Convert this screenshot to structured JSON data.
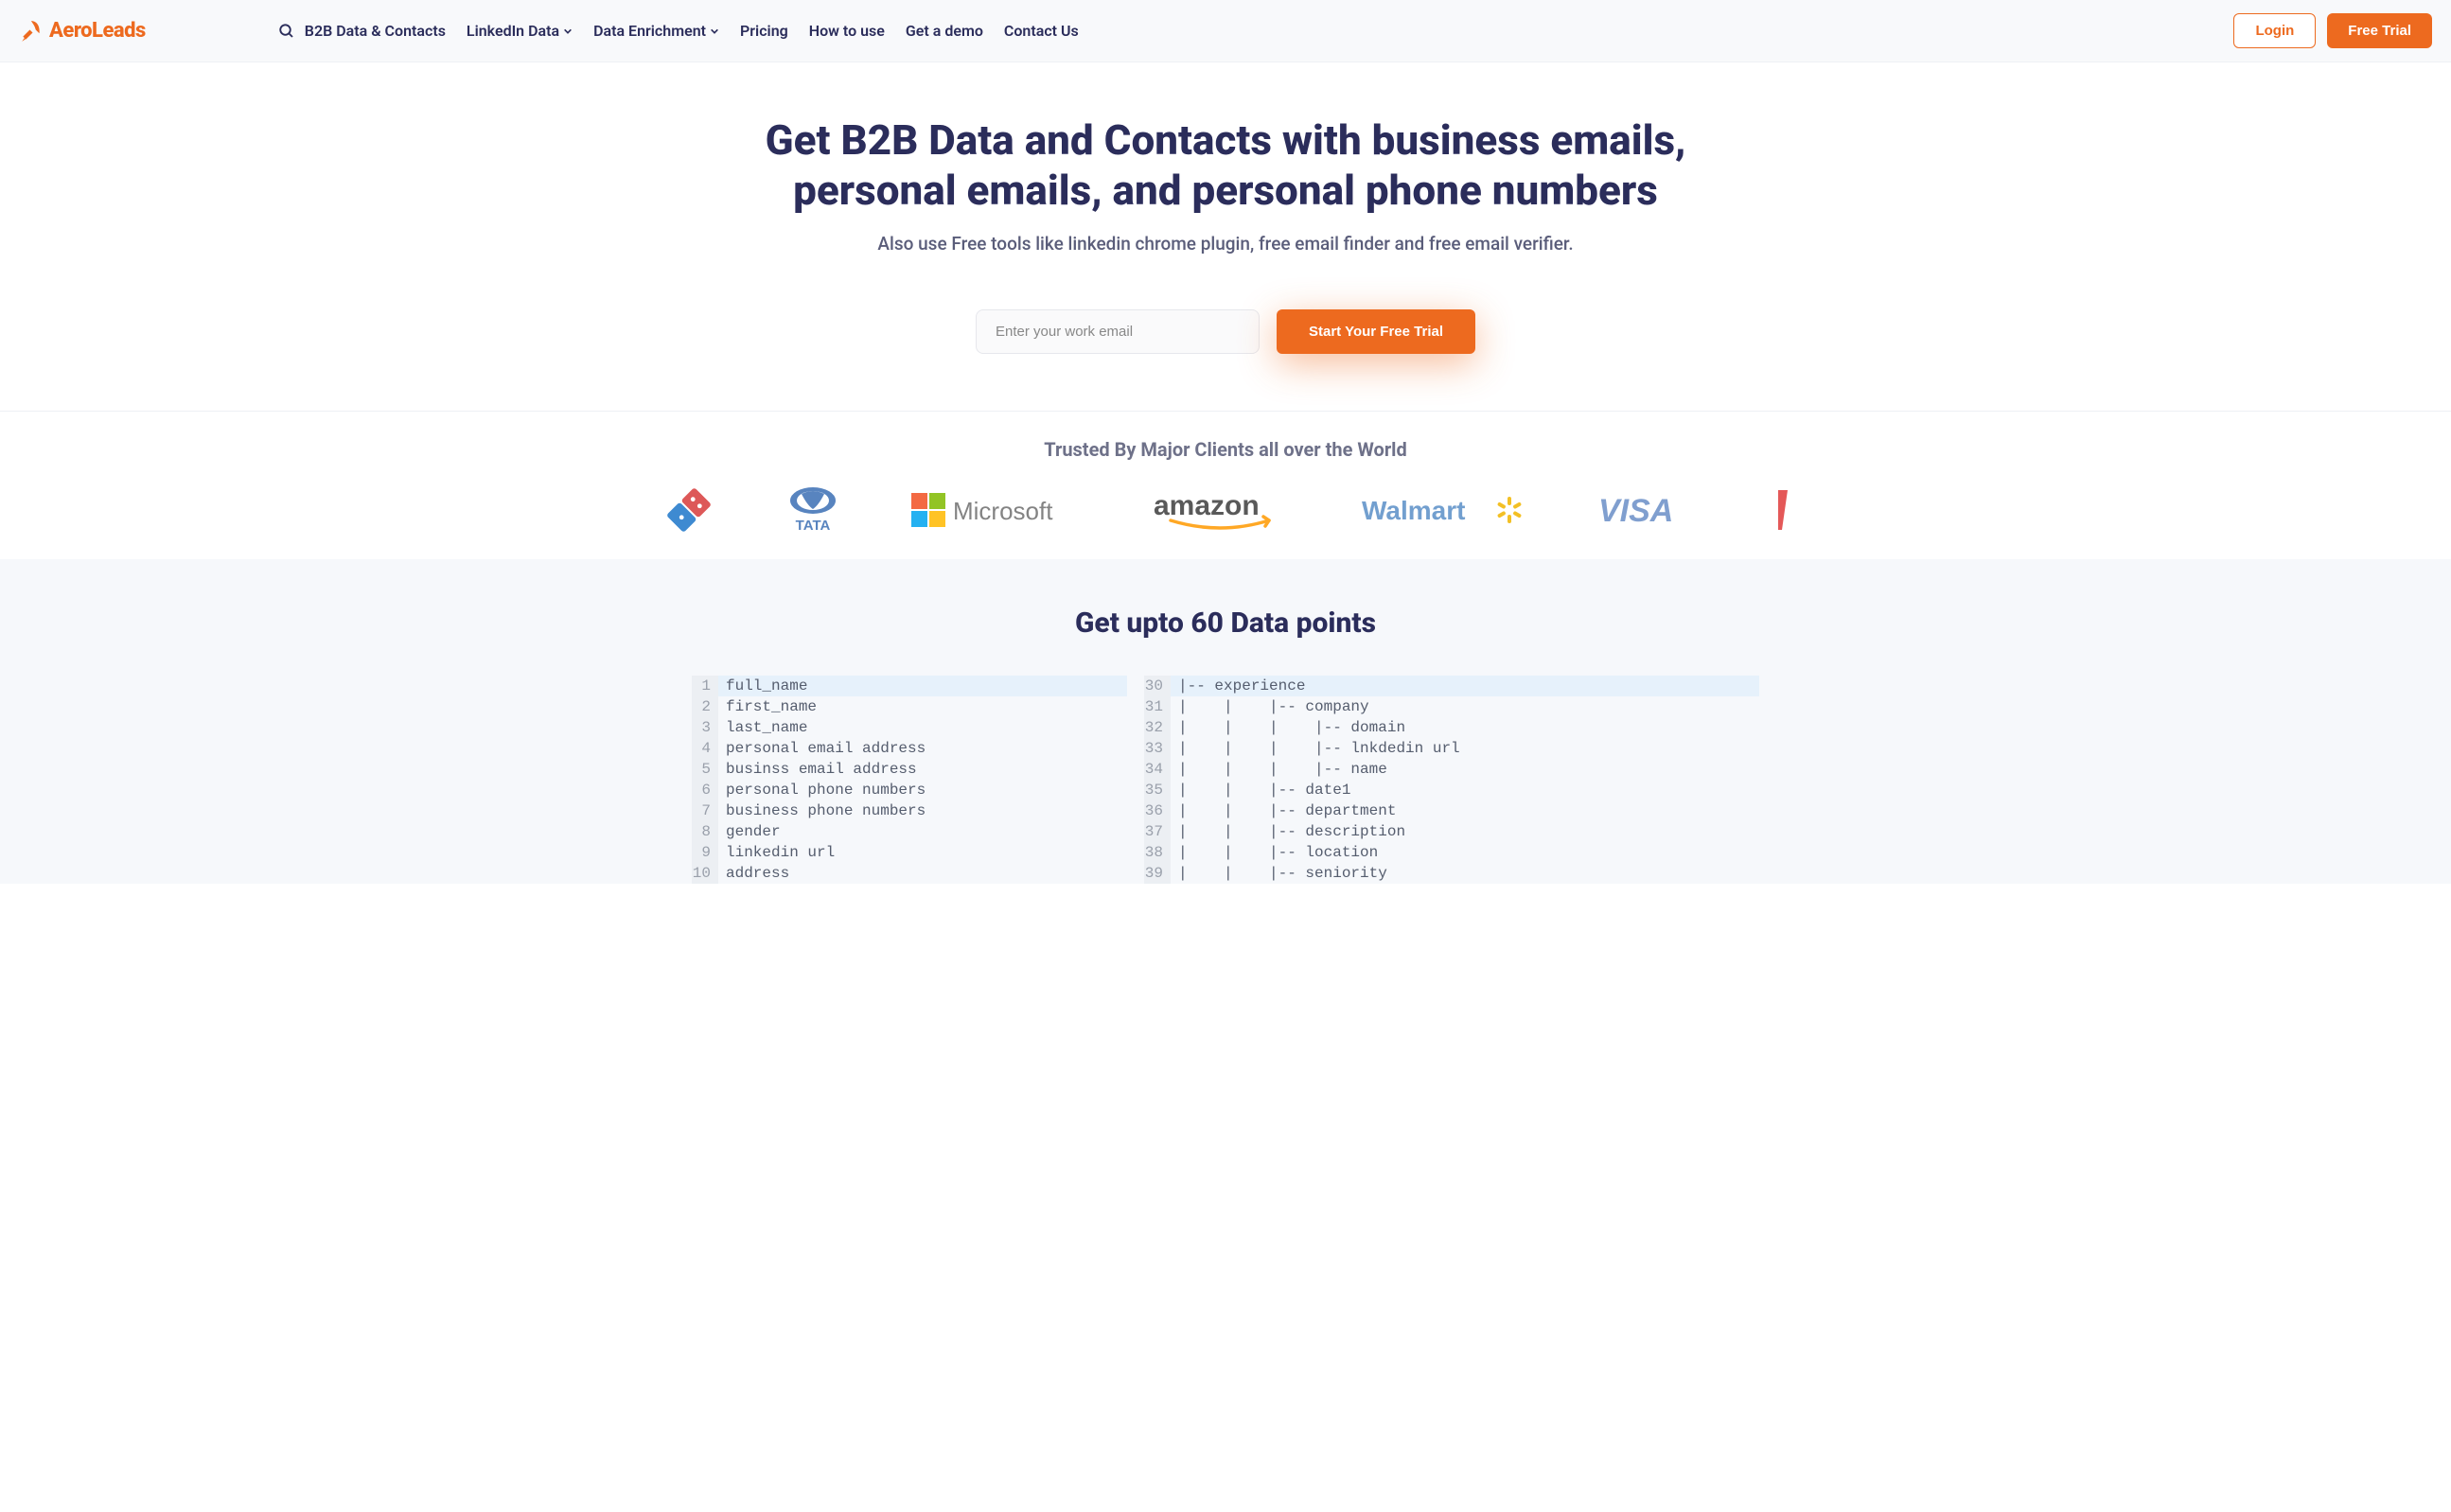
{
  "brand": {
    "name": "AeroLeads"
  },
  "nav": {
    "items": [
      {
        "label": "B2B Data & Contacts",
        "hasSearch": true
      },
      {
        "label": "LinkedIn Data",
        "dropdown": true
      },
      {
        "label": "Data Enrichment",
        "dropdown": true
      },
      {
        "label": "Pricing"
      },
      {
        "label": "How to use"
      },
      {
        "label": "Get a demo"
      },
      {
        "label": "Contact Us"
      }
    ]
  },
  "auth": {
    "login": "Login",
    "trial": "Free Trial"
  },
  "hero": {
    "title": "Get B2B Data and Contacts with business emails, personal emails, and personal phone numbers",
    "subtitle": "Also use Free tools like linkedin chrome plugin, free email finder and free email verifier.",
    "emailPlaceholder": "Enter your work email",
    "cta": "Start Your Free Trial"
  },
  "clients": {
    "heading": "Trusted By Major Clients all over the World",
    "logos": [
      "Domino's",
      "TATA",
      "Microsoft",
      "amazon",
      "Walmart",
      "VISA"
    ]
  },
  "datapoints": {
    "heading": "Get upto 60 Data points",
    "col1": [
      {
        "n": 1,
        "t": "full_name",
        "hl": true
      },
      {
        "n": 2,
        "t": "first_name"
      },
      {
        "n": 3,
        "t": "last_name"
      },
      {
        "n": 4,
        "t": "personal email address"
      },
      {
        "n": 5,
        "t": "businss email address"
      },
      {
        "n": 6,
        "t": "personal phone numbers"
      },
      {
        "n": 7,
        "t": "business phone numbers"
      },
      {
        "n": 8,
        "t": "gender"
      },
      {
        "n": 9,
        "t": "linkedin url"
      },
      {
        "n": 10,
        "t": "address"
      }
    ],
    "col2": [
      {
        "n": 30,
        "t": "|-- experience",
        "hl": true
      },
      {
        "n": 31,
        "t": "|    |    |-- company"
      },
      {
        "n": 32,
        "t": "|    |    |    |-- domain"
      },
      {
        "n": 33,
        "t": "|    |    |    |-- lnkdedin url"
      },
      {
        "n": 34,
        "t": "|    |    |    |-- name"
      },
      {
        "n": 35,
        "t": "|    |    |-- date1"
      },
      {
        "n": 36,
        "t": "|    |    |-- department"
      },
      {
        "n": 37,
        "t": "|    |    |-- description"
      },
      {
        "n": 38,
        "t": "|    |    |-- location"
      },
      {
        "n": 39,
        "t": "|    |    |-- seniority"
      }
    ]
  }
}
